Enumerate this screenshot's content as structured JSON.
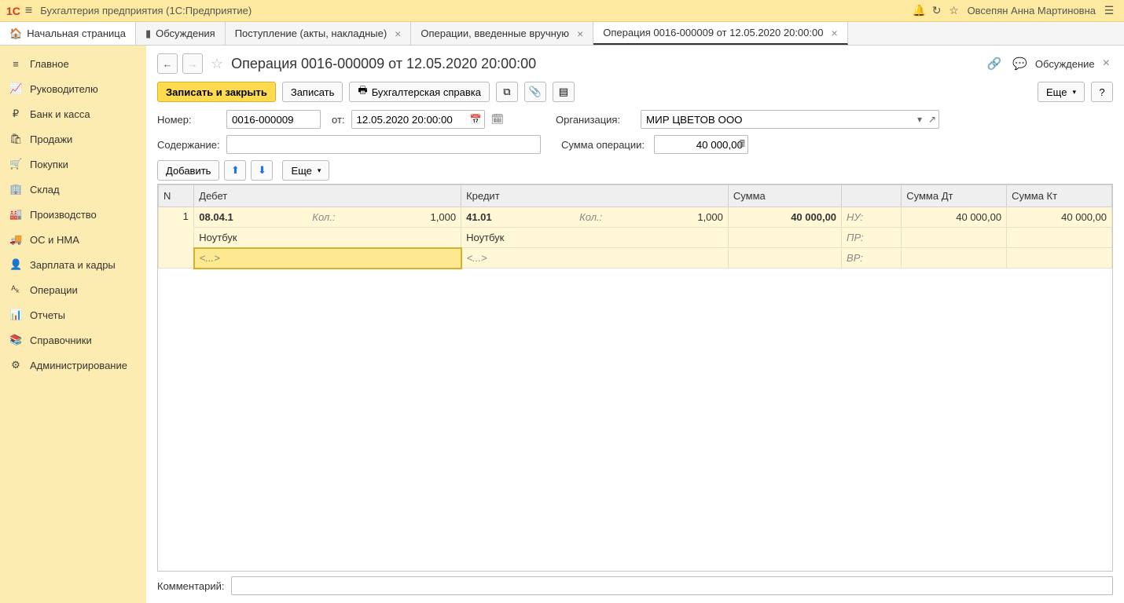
{
  "titlebar": {
    "logo": "1С",
    "app_title": "Бухгалтерия предприятия  (1С:Предприятие)",
    "user": "Овсепян Анна Мартиновна"
  },
  "tabs": [
    {
      "label": "Начальная страница",
      "icon": "🏠",
      "closable": false,
      "home": true
    },
    {
      "label": "Обсуждения",
      "icon": "▮",
      "closable": false
    },
    {
      "label": "Поступление (акты, накладные)",
      "closable": true
    },
    {
      "label": "Операции, введенные вручную",
      "closable": true
    },
    {
      "label": "Операция 0016-000009 от 12.05.2020 20:00:00",
      "closable": true,
      "active": true
    }
  ],
  "sidebar": [
    {
      "icon": "≡",
      "label": "Главное"
    },
    {
      "icon": "📈",
      "label": "Руководителю"
    },
    {
      "icon": "₽",
      "label": "Банк и касса"
    },
    {
      "icon": "🛍",
      "label": "Продажи"
    },
    {
      "icon": "🛒",
      "label": "Покупки"
    },
    {
      "icon": "🏢",
      "label": "Склад"
    },
    {
      "icon": "🏭",
      "label": "Производство"
    },
    {
      "icon": "🚚",
      "label": "ОС и НМА"
    },
    {
      "icon": "👤",
      "label": "Зарплата и кадры"
    },
    {
      "icon": "ᴬₖ",
      "label": "Операции"
    },
    {
      "icon": "📊",
      "label": "Отчеты"
    },
    {
      "icon": "📚",
      "label": "Справочники"
    },
    {
      "icon": "⚙",
      "label": "Администрирование"
    }
  ],
  "page": {
    "title": "Операция 0016-000009 от 12.05.2020 20:00:00",
    "link_icon": "🔗",
    "discuss_label": "Обсуждение"
  },
  "toolbar": {
    "save_close": "Записать и закрыть",
    "save": "Записать",
    "report": "Бухгалтерская справка",
    "more": "Еще",
    "help": "?"
  },
  "form": {
    "number_label": "Номер:",
    "number_value": "0016-000009",
    "date_label": "от:",
    "date_value": "12.05.2020 20:00:00",
    "org_label": "Организация:",
    "org_value": "МИР ЦВЕТОВ ООО",
    "content_label": "Содержание:",
    "content_value": "",
    "sum_label": "Сумма операции:",
    "sum_value": "40 000,00"
  },
  "tbl_toolbar": {
    "add": "Добавить",
    "more": "Еще"
  },
  "table": {
    "headers": {
      "n": "N",
      "debit": "Дебет",
      "credit": "Кредит",
      "sum": "Сумма",
      "sum_dt": "Сумма Дт",
      "sum_kt": "Сумма Кт"
    },
    "row": {
      "n": "1",
      "debit_acct": "08.04.1",
      "debit_qty_lbl": "Кол.:",
      "debit_qty": "1,000",
      "credit_acct": "41.01",
      "credit_qty_lbl": "Кол.:",
      "credit_qty": "1,000",
      "sum": "40 000,00",
      "nu_lbl": "НУ:",
      "nu_dt": "40 000,00",
      "nu_kt": "40 000,00",
      "debit_subc1": "Ноутбук",
      "credit_subc1": "Ноутбук",
      "pr_lbl": "ПР:",
      "edit_placeholder": "<...>",
      "vr_lbl": "ВР:"
    }
  },
  "footer": {
    "comment_label": "Комментарий:",
    "comment_value": ""
  }
}
